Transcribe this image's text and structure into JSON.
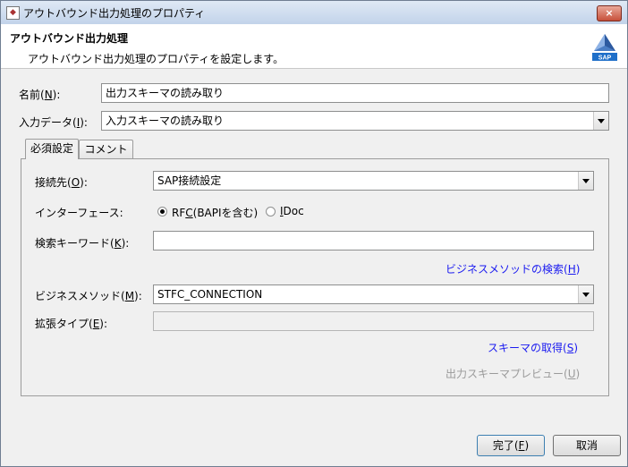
{
  "window": {
    "title": "アウトバウンド出力処理のプロパティ",
    "close_glyph": "×"
  },
  "header": {
    "title": "アウトバウンド出力処理",
    "description": "アウトバウンド出力処理のプロパティを設定します。",
    "logo_text": "SAP"
  },
  "name": {
    "label": "名前(",
    "mnemonic": "N",
    "label_end": "):",
    "value": "出力スキーマの読み取り"
  },
  "input_data": {
    "label": "入力データ(",
    "mnemonic": "I",
    "label_end": "):",
    "value": "入力スキーマの読み取り"
  },
  "tabs": [
    {
      "label": "必須設定",
      "selected": true
    },
    {
      "label": "コメント",
      "selected": false
    }
  ],
  "connection": {
    "label": "接続先(",
    "mnemonic": "O",
    "label_end": "):",
    "value": "SAP接続設定"
  },
  "interface": {
    "label": "インターフェース:",
    "rfc": {
      "text_a": "RF",
      "mnemonic": "C",
      "text_b": "(BAPIを含む)",
      "selected": true
    },
    "idoc": {
      "mnemonic": "I",
      "text": "Doc",
      "selected": false
    }
  },
  "keyword": {
    "label": "検索キーワード(",
    "mnemonic": "K",
    "label_end": "):",
    "value": ""
  },
  "search_link": {
    "text": "ビジネスメソッドの検索(",
    "mnemonic": "H",
    "end": ")"
  },
  "method": {
    "label": "ビジネスメソッド(",
    "mnemonic": "M",
    "label_end": "):",
    "value": "STFC_CONNECTION"
  },
  "ext_type": {
    "label": "拡張タイプ(",
    "mnemonic": "E",
    "label_end": "):",
    "value": ""
  },
  "schema_link": {
    "text": "スキーマの取得(",
    "mnemonic": "S",
    "end": ")"
  },
  "preview_link": {
    "text": "出力スキーマプレビュー(",
    "mnemonic": "U",
    "end": ")"
  },
  "buttons": {
    "finish": {
      "text": "完了(",
      "mnemonic": "F",
      "end": ")"
    },
    "cancel": {
      "label": "取消"
    }
  },
  "colors": {
    "link": "#1a1af0",
    "disabled_link": "#9a9a9a",
    "title_gradient_top": "#dfe9f5",
    "close_red": "#c7503a"
  }
}
